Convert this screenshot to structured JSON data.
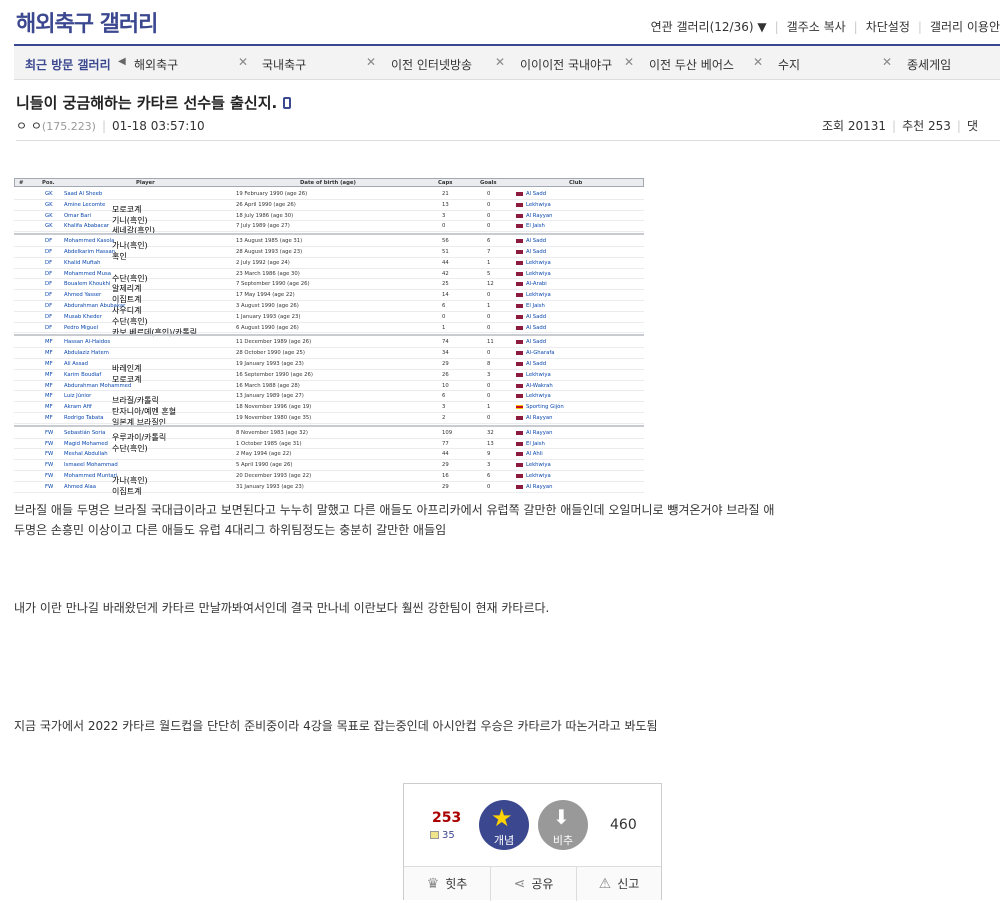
{
  "gallery": {
    "title": "해외축구 갤러리"
  },
  "top_links": [
    "연관 갤러리(12/36)",
    "갤주소 복사",
    "차단설정",
    "갤러리 이용안"
  ],
  "recent": {
    "label": "최근 방문 갤러리",
    "items": [
      "해외축구",
      "국내축구",
      "이전 인터넷방송",
      "이이이전 국내야구",
      "이전 두산 베어스",
      "수지",
      "종세게임"
    ]
  },
  "post": {
    "title": "니들이 궁금해하는 카타르 선수들 출신지.",
    "author": "ㅇ ㅇ",
    "ip": "(175.223)",
    "date": "01-18 03:57:10",
    "views": "조회 20131",
    "recommend": "추천 253",
    "comments_partial": "댓"
  },
  "table": {
    "headers": [
      "#",
      "Pos.",
      "Player",
      "Date of birth (age)",
      "Caps",
      "Goals",
      "Club"
    ],
    "rows": [
      {
        "pos": "GK",
        "player": "Saad Al Sheeb",
        "dob": "19 February 1990 (age 26)",
        "caps": "21",
        "goals": "0",
        "club": "Al Sadd",
        "note": ""
      },
      {
        "pos": "GK",
        "player": "Amine Lecomte",
        "dob": "26 April 1990 (age 26)",
        "caps": "13",
        "goals": "0",
        "club": "Lekhwiya",
        "note": "모로코계"
      },
      {
        "pos": "GK",
        "player": "Omar Bari",
        "dob": "18 July 1986 (age 30)",
        "caps": "3",
        "goals": "0",
        "club": "Al Rayyan",
        "note": "기니(흑인)"
      },
      {
        "pos": "GK",
        "player": "Khalifa Ababacar",
        "dob": "7 July 1989 (age 27)",
        "caps": "0",
        "goals": "0",
        "club": "El Jaish",
        "note": "세네갈(흑인)"
      },
      {
        "pos": "DF",
        "player": "Mohammed Kasola",
        "dob": "13 August 1985 (age 31)",
        "caps": "56",
        "goals": "6",
        "club": "Al Sadd",
        "note": "가나(흑인)"
      },
      {
        "pos": "DF",
        "player": "Abdelkarim Hassan",
        "dob": "28 August 1993 (age 23)",
        "caps": "51",
        "goals": "7",
        "club": "Al Sadd",
        "note": "혹인"
      },
      {
        "pos": "DF",
        "player": "Khalid Muftah",
        "dob": "2 July 1992 (age 24)",
        "caps": "44",
        "goals": "1",
        "club": "Lekhwiya",
        "note": ""
      },
      {
        "pos": "DF",
        "player": "Mohammed Musa",
        "dob": "23 March 1986 (age 30)",
        "caps": "42",
        "goals": "5",
        "club": "Lekhwiya",
        "note": "수단(흑인)"
      },
      {
        "pos": "DF",
        "player": "Boualem Khoukhi",
        "dob": "7 September 1990 (age 26)",
        "caps": "25",
        "goals": "12",
        "club": "Al-Arabi",
        "note": "알제리계"
      },
      {
        "pos": "DF",
        "player": "Ahmed Yasser",
        "dob": "17 May 1994 (age 22)",
        "caps": "14",
        "goals": "0",
        "club": "Lekhwiya",
        "note": "이집트계"
      },
      {
        "pos": "DF",
        "player": "Abdurahman Abubakar",
        "dob": "3 August 1990 (age 26)",
        "caps": "6",
        "goals": "1",
        "club": "El Jaish",
        "note": "사우디계"
      },
      {
        "pos": "DF",
        "player": "Musab Kheder",
        "dob": "1 January 1993 (age 23)",
        "caps": "0",
        "goals": "0",
        "club": "Al Sadd",
        "note": "수단(흑인)"
      },
      {
        "pos": "DF",
        "player": "Pedro Miguel",
        "dob": "6 August 1990 (age 26)",
        "caps": "1",
        "goals": "0",
        "club": "Al Sadd",
        "note": "카보 베르데(흑인)/카톨릭"
      },
      {
        "pos": "MF",
        "player": "Hassan Al-Haidos",
        "dob": "11 December 1989 (age 26)",
        "caps": "74",
        "goals": "11",
        "club": "Al Sadd",
        "note": ""
      },
      {
        "pos": "MF",
        "player": "Abdulaziz Hatem",
        "dob": "28 October 1990 (age 25)",
        "caps": "34",
        "goals": "0",
        "club": "Al-Gharafa",
        "note": ""
      },
      {
        "pos": "MF",
        "player": "Ali Assad",
        "dob": "19 January 1993 (age 23)",
        "caps": "29",
        "goals": "8",
        "club": "Al Sadd",
        "note": "바레인계"
      },
      {
        "pos": "MF",
        "player": "Karim Boudiaf",
        "dob": "16 September 1990 (age 26)",
        "caps": "26",
        "goals": "3",
        "club": "Lekhwiya",
        "note": "모로코계"
      },
      {
        "pos": "MF",
        "player": "Abdurahman Mohammed",
        "dob": "16 March 1988 (age 28)",
        "caps": "10",
        "goals": "0",
        "club": "Al-Wakrah",
        "note": ""
      },
      {
        "pos": "MF",
        "player": "Luiz Júnior",
        "dob": "13 January 1989 (age 27)",
        "caps": "6",
        "goals": "0",
        "club": "Lekhwiya",
        "note": "브라질/카톨릭"
      },
      {
        "pos": "MF",
        "player": "Akram Afif",
        "dob": "18 November 1996 (age 19)",
        "caps": "3",
        "goals": "1",
        "club": "Sporting Gijón",
        "note": "탄자니아/예멘 혼혈"
      },
      {
        "pos": "MF",
        "player": "Rodrigo Tabata",
        "dob": "19 November 1980 (age 35)",
        "caps": "2",
        "goals": "0",
        "club": "Al Rayyan",
        "note": "일본계 브라질인"
      },
      {
        "pos": "FW",
        "player": "Sebastián Soria",
        "dob": "8 November 1983 (age 32)",
        "caps": "109",
        "goals": "32",
        "club": "Al Rayyan",
        "note": "우루과이/카톨릭"
      },
      {
        "pos": "FW",
        "player": "Magid Mohamed",
        "dob": "1 October 1985 (age 31)",
        "caps": "77",
        "goals": "13",
        "club": "El Jaish",
        "note": "수단(흑인)"
      },
      {
        "pos": "FW",
        "player": "Meshal Abdullah",
        "dob": "2 May 1994 (age 22)",
        "caps": "44",
        "goals": "9",
        "club": "Al Ahli",
        "note": ""
      },
      {
        "pos": "FW",
        "player": "Ismaeel Mohammad",
        "dob": "5 April 1990 (age 26)",
        "caps": "29",
        "goals": "3",
        "club": "Lekhwiya",
        "note": ""
      },
      {
        "pos": "FW",
        "player": "Mohammed Muntari",
        "dob": "20 December 1993 (age 22)",
        "caps": "16",
        "goals": "6",
        "club": "Lekhwiya",
        "note": "가나(흑인)"
      },
      {
        "pos": "FW",
        "player": "Ahmed Alaa",
        "dob": "31 January 1993 (age 23)",
        "caps": "29",
        "goals": "0",
        "club": "Al Rayyan",
        "note": "이집트계"
      }
    ]
  },
  "body": {
    "p1": "브라질 애들 두명은 브라질 국대급이라고 보면된다고 누누히 말했고 다른 애들도 아프리카에서 유럽쪽 갈만한 애들인데 오일머니로 뺑겨온거야 브라질 애",
    "p2": "두명은 손흥민 이상이고 다른 애들도 유럽 4대리그 하위팀정도는 충분히 갈만한 애들임",
    "p3": "내가 이란 만나길 바래왔던게 카타르 만날까봐여서인데 결국 만나네 이란보다 훨씬 강한팀이 현재 카타르다.",
    "p4": "지금 국가에서 2022 카타르 월드컵을 단단히 준비중이라 4강을 목표로 잡는중인데 아시안컵 우승은 카타르가 따논거라고 봐도됨"
  },
  "vote": {
    "up_count": "253",
    "fixed_count": "35",
    "up_label": "개념",
    "down_label": "비추",
    "down_count": "460",
    "hits_label": "힛추",
    "share_label": "공유",
    "report_label": "신고"
  }
}
